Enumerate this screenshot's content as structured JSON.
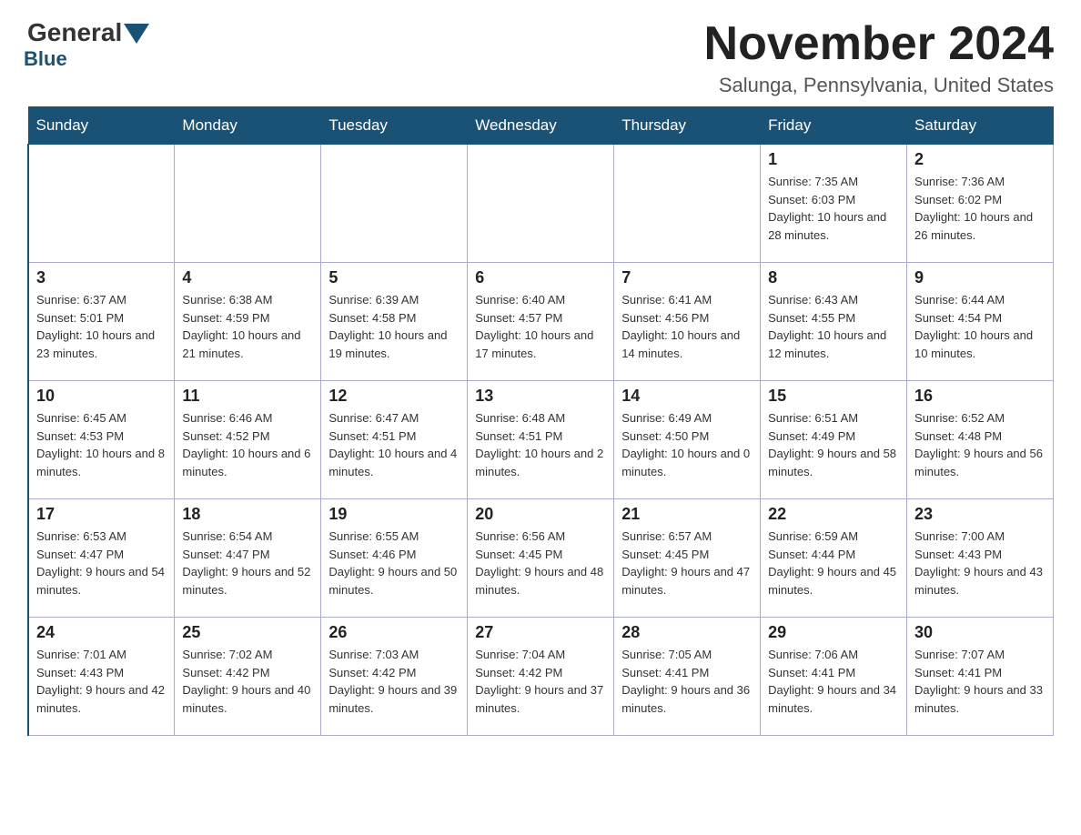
{
  "logo": {
    "general": "General",
    "blue": "Blue"
  },
  "title": "November 2024",
  "location": "Salunga, Pennsylvania, United States",
  "weekdays": [
    "Sunday",
    "Monday",
    "Tuesday",
    "Wednesday",
    "Thursday",
    "Friday",
    "Saturday"
  ],
  "weeks": [
    [
      {
        "day": "",
        "info": ""
      },
      {
        "day": "",
        "info": ""
      },
      {
        "day": "",
        "info": ""
      },
      {
        "day": "",
        "info": ""
      },
      {
        "day": "",
        "info": ""
      },
      {
        "day": "1",
        "info": "Sunrise: 7:35 AM\nSunset: 6:03 PM\nDaylight: 10 hours and 28 minutes."
      },
      {
        "day": "2",
        "info": "Sunrise: 7:36 AM\nSunset: 6:02 PM\nDaylight: 10 hours and 26 minutes."
      }
    ],
    [
      {
        "day": "3",
        "info": "Sunrise: 6:37 AM\nSunset: 5:01 PM\nDaylight: 10 hours and 23 minutes."
      },
      {
        "day": "4",
        "info": "Sunrise: 6:38 AM\nSunset: 4:59 PM\nDaylight: 10 hours and 21 minutes."
      },
      {
        "day": "5",
        "info": "Sunrise: 6:39 AM\nSunset: 4:58 PM\nDaylight: 10 hours and 19 minutes."
      },
      {
        "day": "6",
        "info": "Sunrise: 6:40 AM\nSunset: 4:57 PM\nDaylight: 10 hours and 17 minutes."
      },
      {
        "day": "7",
        "info": "Sunrise: 6:41 AM\nSunset: 4:56 PM\nDaylight: 10 hours and 14 minutes."
      },
      {
        "day": "8",
        "info": "Sunrise: 6:43 AM\nSunset: 4:55 PM\nDaylight: 10 hours and 12 minutes."
      },
      {
        "day": "9",
        "info": "Sunrise: 6:44 AM\nSunset: 4:54 PM\nDaylight: 10 hours and 10 minutes."
      }
    ],
    [
      {
        "day": "10",
        "info": "Sunrise: 6:45 AM\nSunset: 4:53 PM\nDaylight: 10 hours and 8 minutes."
      },
      {
        "day": "11",
        "info": "Sunrise: 6:46 AM\nSunset: 4:52 PM\nDaylight: 10 hours and 6 minutes."
      },
      {
        "day": "12",
        "info": "Sunrise: 6:47 AM\nSunset: 4:51 PM\nDaylight: 10 hours and 4 minutes."
      },
      {
        "day": "13",
        "info": "Sunrise: 6:48 AM\nSunset: 4:51 PM\nDaylight: 10 hours and 2 minutes."
      },
      {
        "day": "14",
        "info": "Sunrise: 6:49 AM\nSunset: 4:50 PM\nDaylight: 10 hours and 0 minutes."
      },
      {
        "day": "15",
        "info": "Sunrise: 6:51 AM\nSunset: 4:49 PM\nDaylight: 9 hours and 58 minutes."
      },
      {
        "day": "16",
        "info": "Sunrise: 6:52 AM\nSunset: 4:48 PM\nDaylight: 9 hours and 56 minutes."
      }
    ],
    [
      {
        "day": "17",
        "info": "Sunrise: 6:53 AM\nSunset: 4:47 PM\nDaylight: 9 hours and 54 minutes."
      },
      {
        "day": "18",
        "info": "Sunrise: 6:54 AM\nSunset: 4:47 PM\nDaylight: 9 hours and 52 minutes."
      },
      {
        "day": "19",
        "info": "Sunrise: 6:55 AM\nSunset: 4:46 PM\nDaylight: 9 hours and 50 minutes."
      },
      {
        "day": "20",
        "info": "Sunrise: 6:56 AM\nSunset: 4:45 PM\nDaylight: 9 hours and 48 minutes."
      },
      {
        "day": "21",
        "info": "Sunrise: 6:57 AM\nSunset: 4:45 PM\nDaylight: 9 hours and 47 minutes."
      },
      {
        "day": "22",
        "info": "Sunrise: 6:59 AM\nSunset: 4:44 PM\nDaylight: 9 hours and 45 minutes."
      },
      {
        "day": "23",
        "info": "Sunrise: 7:00 AM\nSunset: 4:43 PM\nDaylight: 9 hours and 43 minutes."
      }
    ],
    [
      {
        "day": "24",
        "info": "Sunrise: 7:01 AM\nSunset: 4:43 PM\nDaylight: 9 hours and 42 minutes."
      },
      {
        "day": "25",
        "info": "Sunrise: 7:02 AM\nSunset: 4:42 PM\nDaylight: 9 hours and 40 minutes."
      },
      {
        "day": "26",
        "info": "Sunrise: 7:03 AM\nSunset: 4:42 PM\nDaylight: 9 hours and 39 minutes."
      },
      {
        "day": "27",
        "info": "Sunrise: 7:04 AM\nSunset: 4:42 PM\nDaylight: 9 hours and 37 minutes."
      },
      {
        "day": "28",
        "info": "Sunrise: 7:05 AM\nSunset: 4:41 PM\nDaylight: 9 hours and 36 minutes."
      },
      {
        "day": "29",
        "info": "Sunrise: 7:06 AM\nSunset: 4:41 PM\nDaylight: 9 hours and 34 minutes."
      },
      {
        "day": "30",
        "info": "Sunrise: 7:07 AM\nSunset: 4:41 PM\nDaylight: 9 hours and 33 minutes."
      }
    ]
  ]
}
